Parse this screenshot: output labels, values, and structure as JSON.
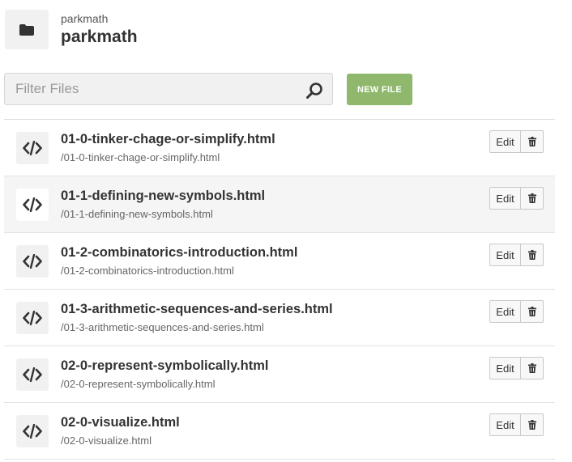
{
  "header": {
    "breadcrumb": "parkmath",
    "title": "parkmath",
    "folder_icon": "folder-icon"
  },
  "filter": {
    "placeholder": "Filter Files",
    "value": "",
    "icon": "search-icon"
  },
  "new_file_label": "NEW FILE",
  "files": [
    {
      "name": "01-0-tinker-chage-or-simplify.html",
      "path": "/01-0-tinker-chage-or-simplify.html",
      "edit_label": "Edit"
    },
    {
      "name": "01-1-defining-new-symbols.html",
      "path": "/01-1-defining-new-symbols.html",
      "edit_label": "Edit"
    },
    {
      "name": "01-2-combinatorics-introduction.html",
      "path": "/01-2-combinatorics-introduction.html",
      "edit_label": "Edit"
    },
    {
      "name": "01-3-arithmetic-sequences-and-series.html",
      "path": "/01-3-arithmetic-sequences-and-series.html",
      "edit_label": "Edit"
    },
    {
      "name": "02-0-represent-symbolically.html",
      "path": "/02-0-represent-symbolically.html",
      "edit_label": "Edit"
    },
    {
      "name": "02-0-visualize.html",
      "path": "/02-0-visualize.html",
      "edit_label": "Edit"
    }
  ],
  "colors": {
    "accent_button": "#8fb86c",
    "row_highlight": "#f5f5f5"
  }
}
